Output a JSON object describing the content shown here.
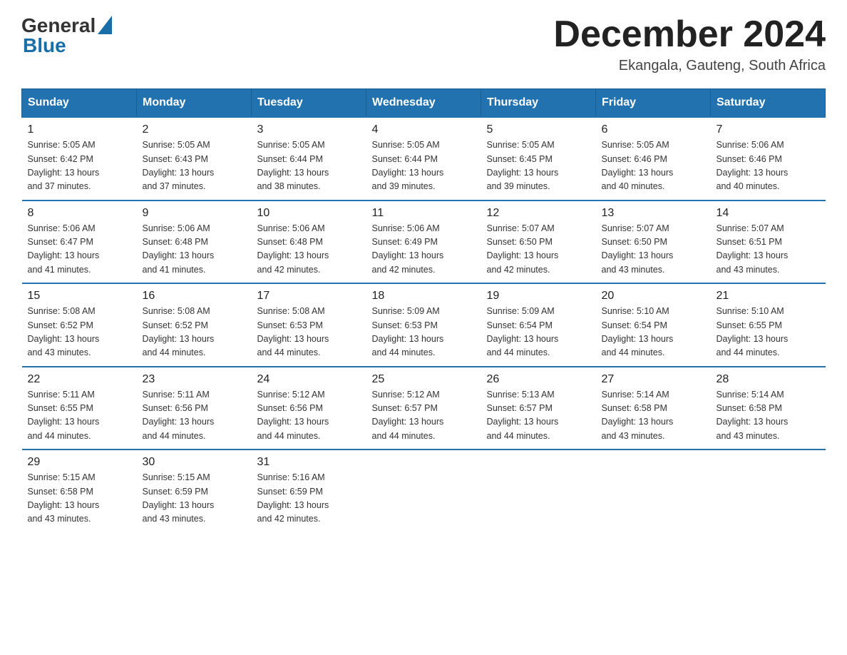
{
  "header": {
    "logo_general": "General",
    "logo_blue": "Blue",
    "month_title": "December 2024",
    "location": "Ekangala, Gauteng, South Africa"
  },
  "weekdays": [
    "Sunday",
    "Monday",
    "Tuesday",
    "Wednesday",
    "Thursday",
    "Friday",
    "Saturday"
  ],
  "weeks": [
    [
      {
        "day": "1",
        "sunrise": "5:05 AM",
        "sunset": "6:42 PM",
        "daylight": "13 hours and 37 minutes."
      },
      {
        "day": "2",
        "sunrise": "5:05 AM",
        "sunset": "6:43 PM",
        "daylight": "13 hours and 37 minutes."
      },
      {
        "day": "3",
        "sunrise": "5:05 AM",
        "sunset": "6:44 PM",
        "daylight": "13 hours and 38 minutes."
      },
      {
        "day": "4",
        "sunrise": "5:05 AM",
        "sunset": "6:44 PM",
        "daylight": "13 hours and 39 minutes."
      },
      {
        "day": "5",
        "sunrise": "5:05 AM",
        "sunset": "6:45 PM",
        "daylight": "13 hours and 39 minutes."
      },
      {
        "day": "6",
        "sunrise": "5:05 AM",
        "sunset": "6:46 PM",
        "daylight": "13 hours and 40 minutes."
      },
      {
        "day": "7",
        "sunrise": "5:06 AM",
        "sunset": "6:46 PM",
        "daylight": "13 hours and 40 minutes."
      }
    ],
    [
      {
        "day": "8",
        "sunrise": "5:06 AM",
        "sunset": "6:47 PM",
        "daylight": "13 hours and 41 minutes."
      },
      {
        "day": "9",
        "sunrise": "5:06 AM",
        "sunset": "6:48 PM",
        "daylight": "13 hours and 41 minutes."
      },
      {
        "day": "10",
        "sunrise": "5:06 AM",
        "sunset": "6:48 PM",
        "daylight": "13 hours and 42 minutes."
      },
      {
        "day": "11",
        "sunrise": "5:06 AM",
        "sunset": "6:49 PM",
        "daylight": "13 hours and 42 minutes."
      },
      {
        "day": "12",
        "sunrise": "5:07 AM",
        "sunset": "6:50 PM",
        "daylight": "13 hours and 42 minutes."
      },
      {
        "day": "13",
        "sunrise": "5:07 AM",
        "sunset": "6:50 PM",
        "daylight": "13 hours and 43 minutes."
      },
      {
        "day": "14",
        "sunrise": "5:07 AM",
        "sunset": "6:51 PM",
        "daylight": "13 hours and 43 minutes."
      }
    ],
    [
      {
        "day": "15",
        "sunrise": "5:08 AM",
        "sunset": "6:52 PM",
        "daylight": "13 hours and 43 minutes."
      },
      {
        "day": "16",
        "sunrise": "5:08 AM",
        "sunset": "6:52 PM",
        "daylight": "13 hours and 44 minutes."
      },
      {
        "day": "17",
        "sunrise": "5:08 AM",
        "sunset": "6:53 PM",
        "daylight": "13 hours and 44 minutes."
      },
      {
        "day": "18",
        "sunrise": "5:09 AM",
        "sunset": "6:53 PM",
        "daylight": "13 hours and 44 minutes."
      },
      {
        "day": "19",
        "sunrise": "5:09 AM",
        "sunset": "6:54 PM",
        "daylight": "13 hours and 44 minutes."
      },
      {
        "day": "20",
        "sunrise": "5:10 AM",
        "sunset": "6:54 PM",
        "daylight": "13 hours and 44 minutes."
      },
      {
        "day": "21",
        "sunrise": "5:10 AM",
        "sunset": "6:55 PM",
        "daylight": "13 hours and 44 minutes."
      }
    ],
    [
      {
        "day": "22",
        "sunrise": "5:11 AM",
        "sunset": "6:55 PM",
        "daylight": "13 hours and 44 minutes."
      },
      {
        "day": "23",
        "sunrise": "5:11 AM",
        "sunset": "6:56 PM",
        "daylight": "13 hours and 44 minutes."
      },
      {
        "day": "24",
        "sunrise": "5:12 AM",
        "sunset": "6:56 PM",
        "daylight": "13 hours and 44 minutes."
      },
      {
        "day": "25",
        "sunrise": "5:12 AM",
        "sunset": "6:57 PM",
        "daylight": "13 hours and 44 minutes."
      },
      {
        "day": "26",
        "sunrise": "5:13 AM",
        "sunset": "6:57 PM",
        "daylight": "13 hours and 44 minutes."
      },
      {
        "day": "27",
        "sunrise": "5:14 AM",
        "sunset": "6:58 PM",
        "daylight": "13 hours and 43 minutes."
      },
      {
        "day": "28",
        "sunrise": "5:14 AM",
        "sunset": "6:58 PM",
        "daylight": "13 hours and 43 minutes."
      }
    ],
    [
      {
        "day": "29",
        "sunrise": "5:15 AM",
        "sunset": "6:58 PM",
        "daylight": "13 hours and 43 minutes."
      },
      {
        "day": "30",
        "sunrise": "5:15 AM",
        "sunset": "6:59 PM",
        "daylight": "13 hours and 43 minutes."
      },
      {
        "day": "31",
        "sunrise": "5:16 AM",
        "sunset": "6:59 PM",
        "daylight": "13 hours and 42 minutes."
      },
      null,
      null,
      null,
      null
    ]
  ],
  "labels": {
    "sunrise": "Sunrise: ",
    "sunset": "Sunset: ",
    "daylight": "Daylight: "
  }
}
